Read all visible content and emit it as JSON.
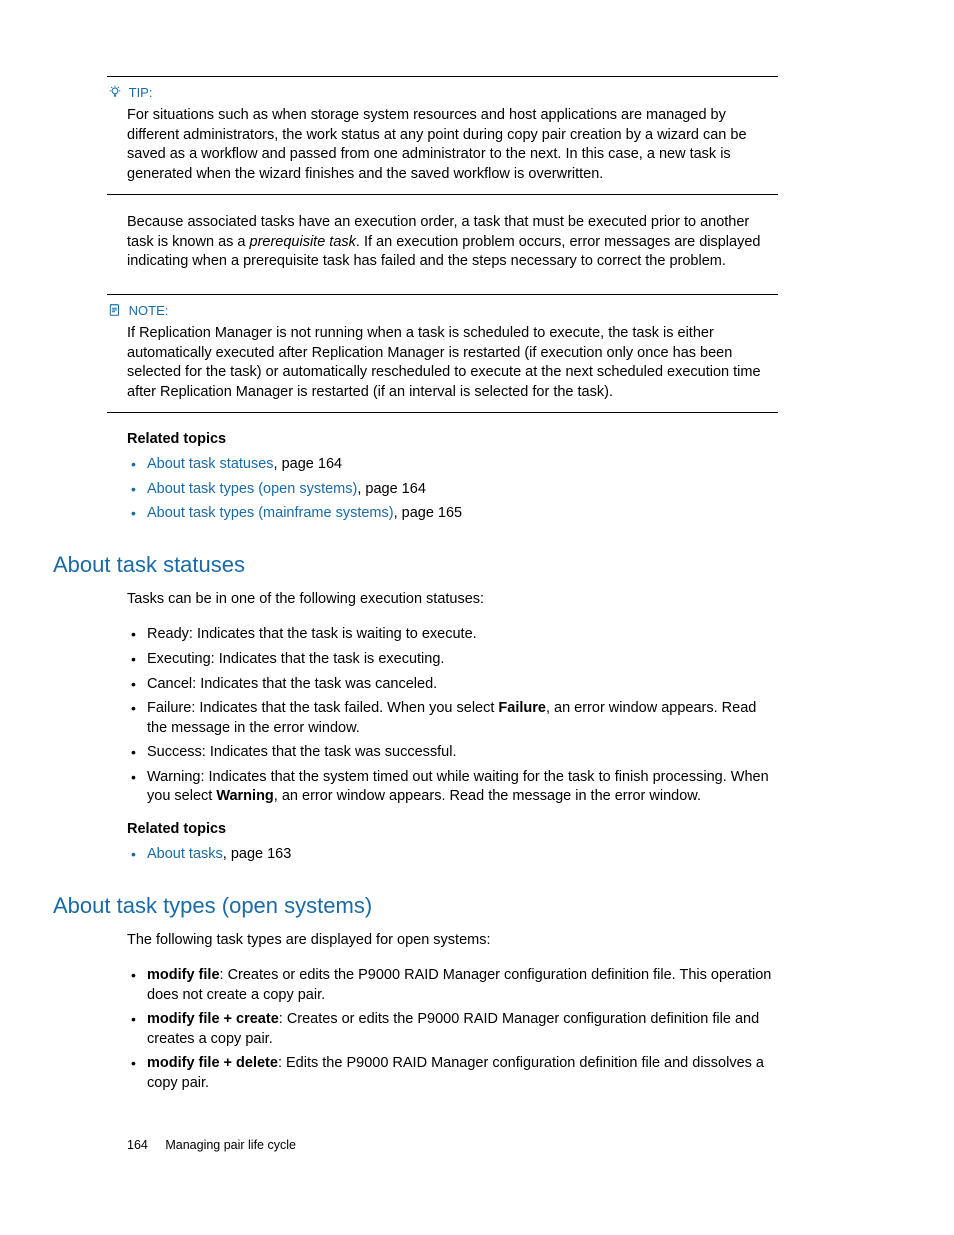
{
  "tip": {
    "label": "TIP:",
    "body": "For situations such as when storage system resources and host applications are managed by different administrators, the work status at any point during copy pair creation by a wizard can be saved as a workflow and passed from one administrator to the next. In this case, a new task is generated when the wizard finishes and the saved workflow is overwritten."
  },
  "para_prereq": {
    "before": "Because associated tasks have an execution order, a task that must be executed prior to another task is known as a ",
    "italic": "prerequisite task",
    "after": ". If an execution problem occurs, error messages are displayed indicating when a prerequisite task has failed and the steps necessary to correct the problem."
  },
  "note": {
    "label": "NOTE:",
    "body": "If Replication Manager is not running when a task is scheduled to execute, the task is either automatically executed after Replication Manager is restarted (if execution only once has been selected for the task) or automatically rescheduled to execute at the next scheduled execution time after Replication Manager is restarted (if an interval is selected for the task)."
  },
  "related1": {
    "heading": "Related topics",
    "items": [
      {
        "link": "About task statuses",
        "suffix": ", page 164"
      },
      {
        "link": "About task types (open systems)",
        "suffix": ", page 164"
      },
      {
        "link": "About task types (mainframe systems)",
        "suffix": ", page 165"
      }
    ]
  },
  "statuses": {
    "heading": "About task statuses",
    "intro": "Tasks can be in one of the following execution statuses:",
    "items": {
      "ready": "Ready: Indicates that the task is waiting to execute.",
      "executing": "Executing: Indicates that the task is executing.",
      "cancel": "Cancel: Indicates that the task was canceled.",
      "failure_before": "Failure: Indicates that the task failed. When you select ",
      "failure_bold": "Failure",
      "failure_after": ", an error window appears. Read the message in the error window.",
      "success": "Success: Indicates that the task was successful.",
      "warning_before": "Warning: Indicates that the system timed out while waiting for the task to finish processing. When you select ",
      "warning_bold": "Warning",
      "warning_after": ", an error window appears. Read the message in the error window."
    },
    "related": {
      "heading": "Related topics",
      "items": [
        {
          "link": "About tasks",
          "suffix": ", page 163"
        }
      ]
    }
  },
  "types": {
    "heading": "About task types (open systems)",
    "intro": "The following task types are displayed for open systems:",
    "items": {
      "mf_label": "modify file",
      "mf_text": ": Creates or edits the P9000 RAID Manager configuration definition file. This operation does not create a copy pair.",
      "mfc_label": "modify file + create",
      "mfc_text": ": Creates or edits the P9000 RAID Manager configuration definition file and creates a copy pair.",
      "mfd_label": "modify file + delete",
      "mfd_text": ": Edits the P9000 RAID Manager configuration definition file and dissolves a copy pair."
    }
  },
  "footer": {
    "page": "164",
    "chapter": "Managing pair life cycle"
  }
}
